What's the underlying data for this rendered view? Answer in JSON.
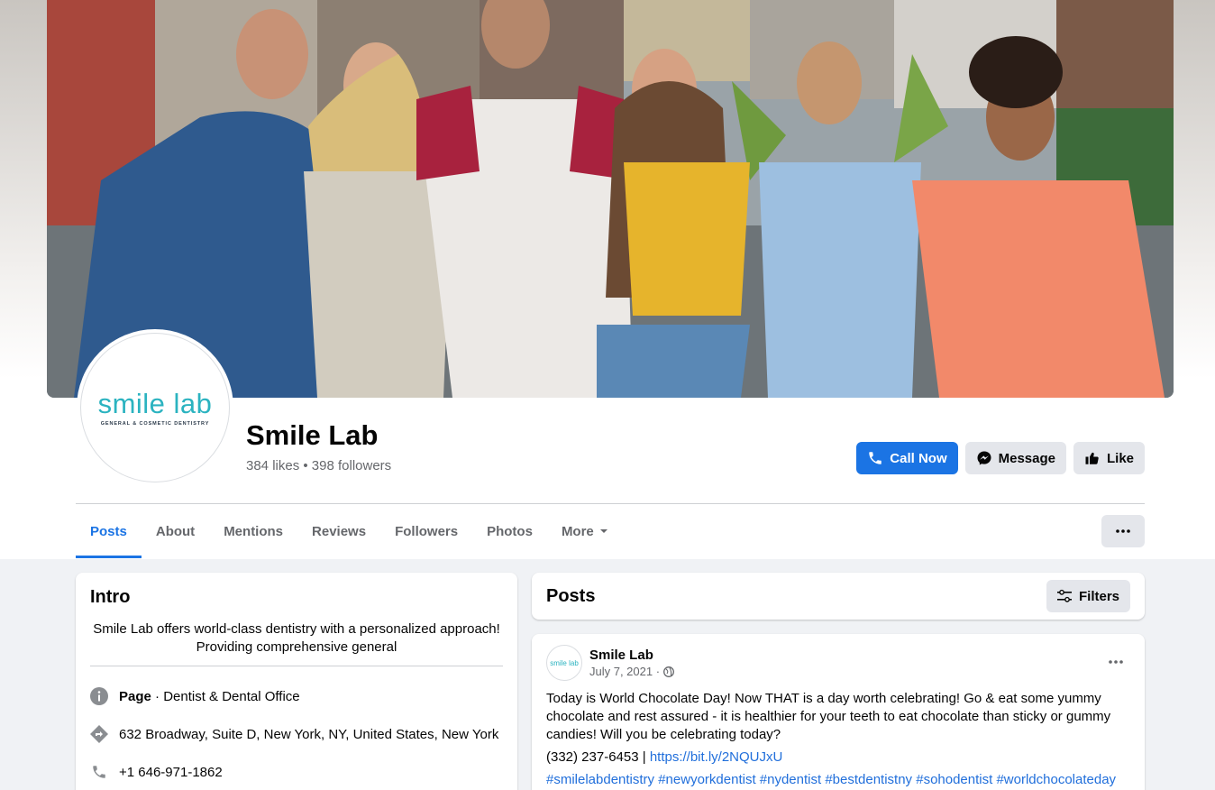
{
  "profile": {
    "logo_main": "smile lab",
    "logo_sub": "GENERAL & COSMETIC DENTISTRY",
    "name": "Smile Lab",
    "stats": "384 likes • 398 followers"
  },
  "actions": {
    "call_label": "Call Now",
    "message_label": "Message",
    "like_label": "Like"
  },
  "tabs": [
    {
      "label": "Posts"
    },
    {
      "label": "About"
    },
    {
      "label": "Mentions"
    },
    {
      "label": "Reviews"
    },
    {
      "label": "Followers"
    },
    {
      "label": "Photos"
    },
    {
      "label": "More"
    }
  ],
  "intro": {
    "title": "Intro",
    "bio_line1": "Smile Lab offers world-class dentistry with a personalized approach!",
    "bio_line2": "Providing comprehensive general",
    "page_label": "Page",
    "category": " · Dentist & Dental Office",
    "address": "632 Broadway, Suite D, New York, NY, United States, New York",
    "phone": "+1 646-971-1862"
  },
  "posts_section": {
    "title": "Posts",
    "filters_label": "Filters"
  },
  "post": {
    "avatar_text": "smile lab",
    "author": "Smile Lab",
    "date": "July 7, 2021 ·",
    "body": "Today is World Chocolate Day! Now THAT is a day worth celebrating! Go & eat some yummy chocolate and rest assured - it is healthier for your teeth to eat chocolate than sticky or gummy candies! Will you be celebrating today?",
    "phone": "(332) 237-6453 |",
    "link": "https://bit.ly/2NQUJxU",
    "hashtags": "#smilelabdentistry #newyorkdentist #nydentist #bestdentistny #sohodentist #worldchocolateday"
  },
  "colors": {
    "accent": "#1b74e4",
    "logo_teal": "#2bb3c0",
    "page_bg": "#f0f2f5"
  }
}
